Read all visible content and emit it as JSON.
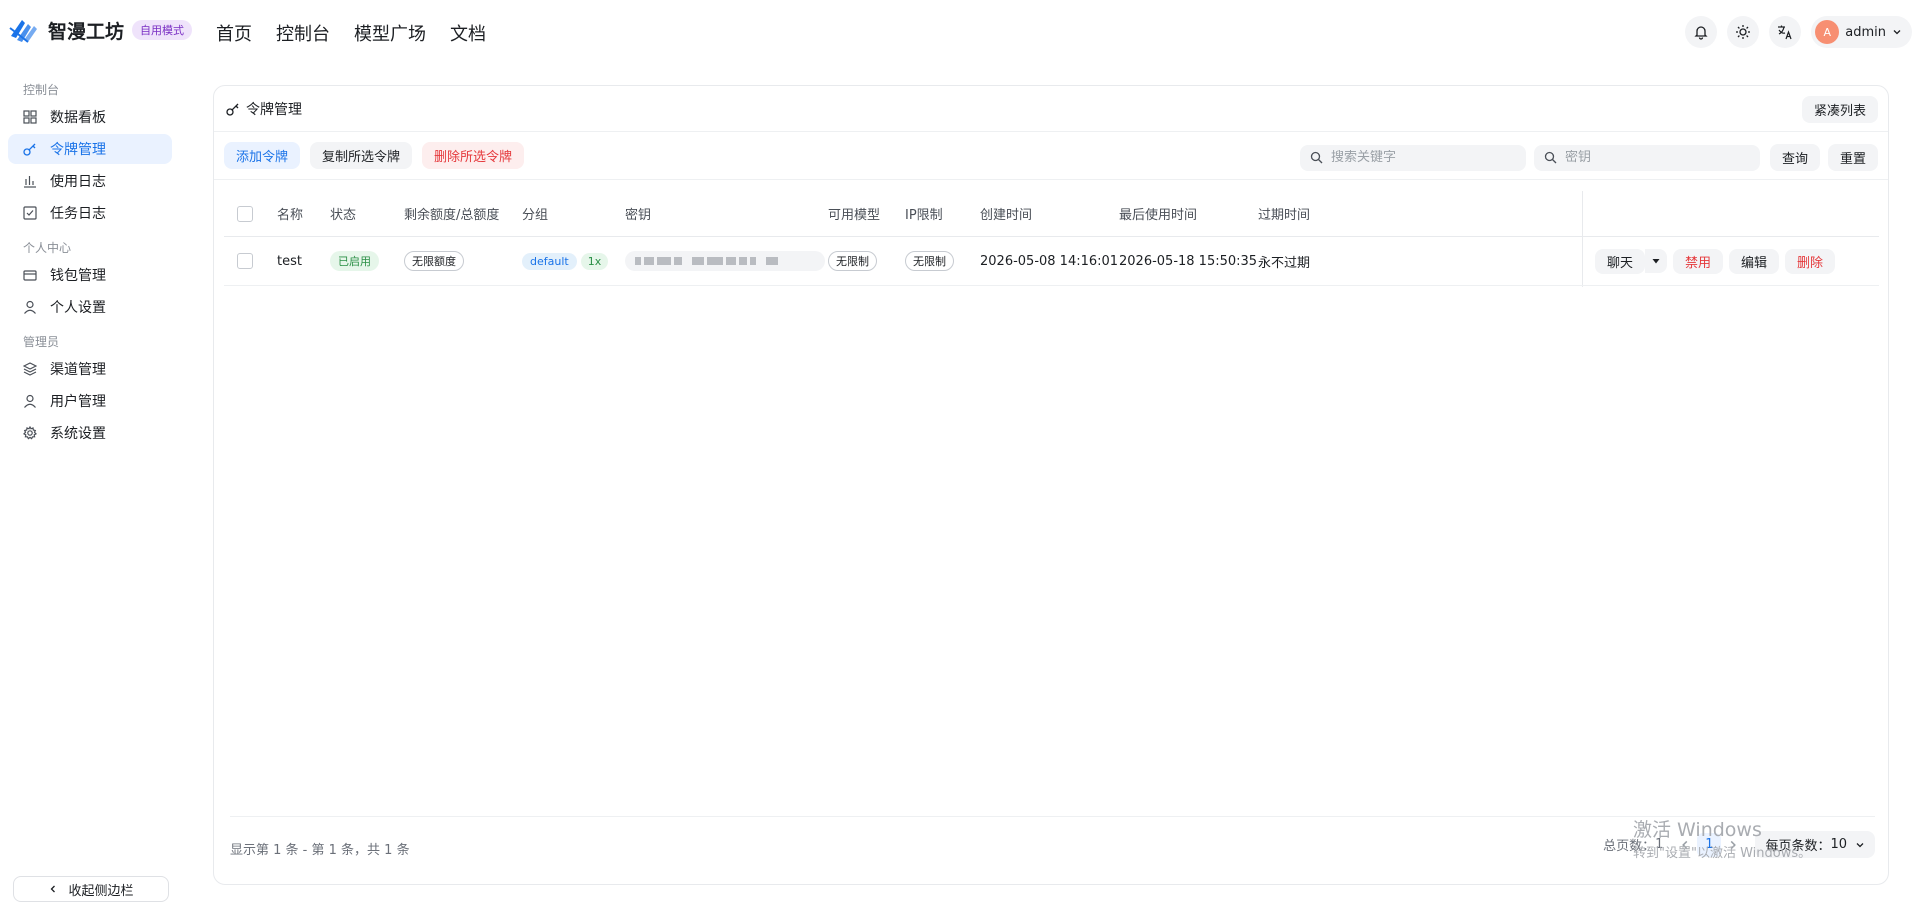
{
  "brand": {
    "name": "智漫工坊",
    "mode_badge": "自用模式"
  },
  "top_nav": [
    "首页",
    "控制台",
    "模型广场",
    "文档"
  ],
  "user": {
    "avatar_letter": "A",
    "name": "admin"
  },
  "sidebar": {
    "group_console": "控制台",
    "items_console": [
      {
        "label": "数据看板",
        "icon": "dashboard-icon"
      },
      {
        "label": "令牌管理",
        "icon": "key-icon",
        "active": true
      },
      {
        "label": "使用日志",
        "icon": "chart-icon"
      },
      {
        "label": "任务日志",
        "icon": "checklist-icon"
      }
    ],
    "group_personal": "个人中心",
    "items_personal": [
      {
        "label": "钱包管理",
        "icon": "wallet-icon"
      },
      {
        "label": "个人设置",
        "icon": "user-icon"
      }
    ],
    "group_admin": "管理员",
    "items_admin": [
      {
        "label": "渠道管理",
        "icon": "layers-icon"
      },
      {
        "label": "用户管理",
        "icon": "user-icon"
      },
      {
        "label": "系统设置",
        "icon": "gear-icon"
      }
    ],
    "collapse_label": "收起侧边栏"
  },
  "card": {
    "title": "令牌管理",
    "compact_label": "紧凑列表",
    "toolbar": {
      "add": "添加令牌",
      "copy": "复制所选令牌",
      "delete": "删除所选令牌",
      "search_placeholder": "搜索关键字",
      "key_placeholder": "密钥",
      "query": "查询",
      "reset": "重置"
    },
    "columns": [
      "名称",
      "状态",
      "剩余额度/总额度",
      "分组",
      "密钥",
      "可用模型",
      "IP限制",
      "创建时间",
      "最后使用时间",
      "过期时间"
    ],
    "rows": [
      {
        "name": "test",
        "status": "已启用",
        "quota": "无限额度",
        "group": "default",
        "ratio": "1x",
        "models": "无限制",
        "ip": "无限制",
        "created": "2026-05-08 14:16:01",
        "last_used": "2026-05-18 15:50:35",
        "expires": "永不过期",
        "actions": {
          "chat": "聊天",
          "disable": "禁用",
          "edit": "编辑",
          "delete": "删除"
        }
      }
    ],
    "footer": {
      "summary": "显示第 1 条 - 第 1 条，共 1 条",
      "total_pages_label": "总页数：",
      "total_pages": "1",
      "current_page": "1",
      "page_size_label": "每页条数：",
      "page_size": "10"
    }
  },
  "watermark": {
    "line1": "激活 Windows",
    "line2": "转到\"设置\"以激活 Windows。"
  },
  "colors": {
    "accent": "#1a73e8",
    "danger": "#e5383b",
    "badge_purple": "#7a2fc4"
  }
}
